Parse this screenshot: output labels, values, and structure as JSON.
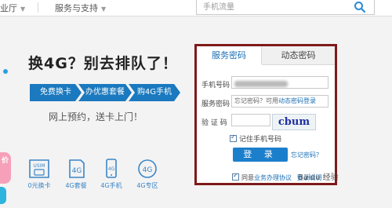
{
  "nav": {
    "item1": "业厅",
    "item2": "服务与支持",
    "search_placeholder": "手机流量"
  },
  "promo": {
    "title": "换4G？别去排队了！",
    "steps": [
      "免费换卡",
      "办优惠套餐",
      "购4G手机"
    ],
    "subtitle": "网上预约，送卡上门！",
    "left_badge": "价",
    "services": [
      {
        "icon": "usim-card-icon",
        "label": "0元换卡"
      },
      {
        "icon": "4g-plan-icon",
        "label": "4G套餐"
      },
      {
        "icon": "4g-phone-icon",
        "label": "4G手机"
      },
      {
        "icon": "4g-zone-icon",
        "label": "4G专区"
      }
    ]
  },
  "login": {
    "tab_service": "服务密码",
    "tab_dynamic": "动态密码",
    "phone_label": "手机号码",
    "password_label": "服务密码",
    "password_placeholder_a": "忘记密码？可用",
    "password_placeholder_b": "动态密码登录",
    "captcha_label": "验 证 码",
    "captcha_text": "cbum",
    "remember_label": "记住手机号码",
    "login_button": "登 录",
    "forgot_link": "忘记密码？",
    "agree_text_a": "同意",
    "agree_text_b": "业务办理协议",
    "agree_text_c": "登录说明"
  },
  "watermark": "Baidu 经验",
  "colors": {
    "frame_border": "#7f1a1a",
    "accent_blue": "#1c7fcc",
    "step_blue": "#1a79bf"
  }
}
